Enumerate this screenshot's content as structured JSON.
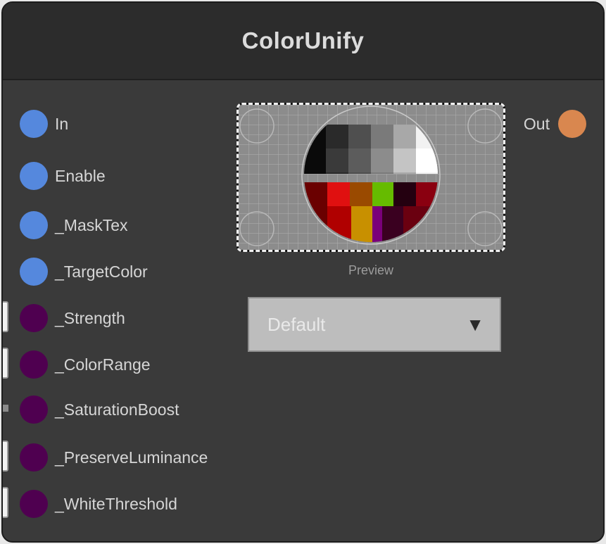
{
  "node": {
    "title": "ColorUnify",
    "inputs": [
      {
        "label": "In",
        "color": "#5588dd",
        "widget": "none"
      },
      {
        "label": "Enable",
        "color": "#5588dd",
        "widget": "none"
      },
      {
        "label": "_MaskTex",
        "color": "#5588dd",
        "widget": "none"
      },
      {
        "label": "_TargetColor",
        "color": "#5588dd",
        "widget": "none"
      },
      {
        "label": "_Strength",
        "color": "#4f0050",
        "widget": "field"
      },
      {
        "label": "_ColorRange",
        "color": "#4f0050",
        "widget": "field"
      },
      {
        "label": "_SaturationBoost",
        "color": "#4f0050",
        "widget": "slider"
      },
      {
        "label": "_PreserveLuminance",
        "color": "#4f0050",
        "widget": "field"
      },
      {
        "label": "_WhiteThreshold",
        "color": "#4f0050",
        "widget": "field"
      }
    ],
    "output": {
      "label": "Out",
      "color": "#d9874f"
    },
    "preview": {
      "caption": "Preview"
    },
    "dropdown": {
      "value": "Default",
      "arrow": "▼"
    }
  }
}
